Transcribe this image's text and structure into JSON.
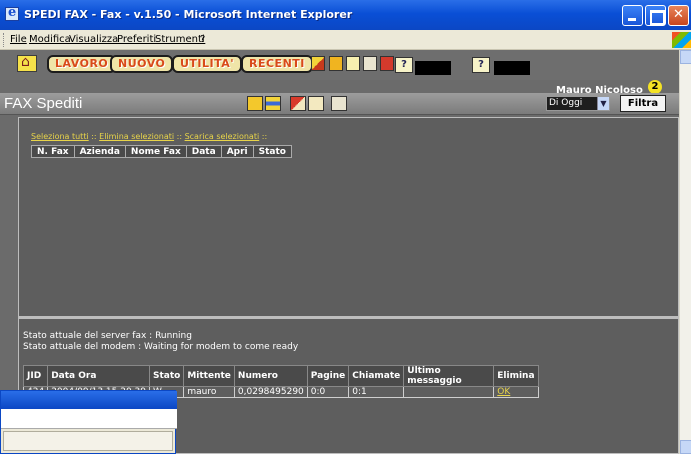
{
  "window": {
    "title": "SPEDI FAX - Fax - v.1.50 - Microsoft Internet Explorer"
  },
  "menu": [
    "File",
    "Modifica",
    "Visualizza",
    "Preferiti",
    "Strumenti",
    "?"
  ],
  "toolbar": {
    "buttons": [
      "LAVORO",
      "NUOVO",
      "UTILITA'",
      "RECENTI"
    ]
  },
  "user": {
    "name": "Mauro Nicoloso",
    "badge": "2"
  },
  "header": {
    "title": "FAX Spediti",
    "filter_value": "Di Oggi",
    "filter_button": "Filtra"
  },
  "actions": [
    "Seleziona tutti",
    "Elimina selezionati",
    "Scarica selezionati"
  ],
  "fax_table": {
    "columns": [
      "N. Fax",
      "Azienda",
      "Nome Fax",
      "Data",
      "Apri",
      "Stato"
    ]
  },
  "status": {
    "server": "Stato attuale del server fax : Running",
    "modem": "Stato attuale del modem : Waiting for modem to come ready"
  },
  "jobs_table": {
    "columns": [
      "JID",
      "Data Ora",
      "Stato",
      "Mittente",
      "Numero",
      "Pagine",
      "Chiamate",
      "Ultimo messaggio",
      "Elimina"
    ],
    "rows": [
      [
        "424",
        "2004/09/13 15.20.39",
        "W",
        "mauro",
        "0,0298495290",
        "0:0",
        "0:1",
        "",
        "OK"
      ]
    ]
  }
}
